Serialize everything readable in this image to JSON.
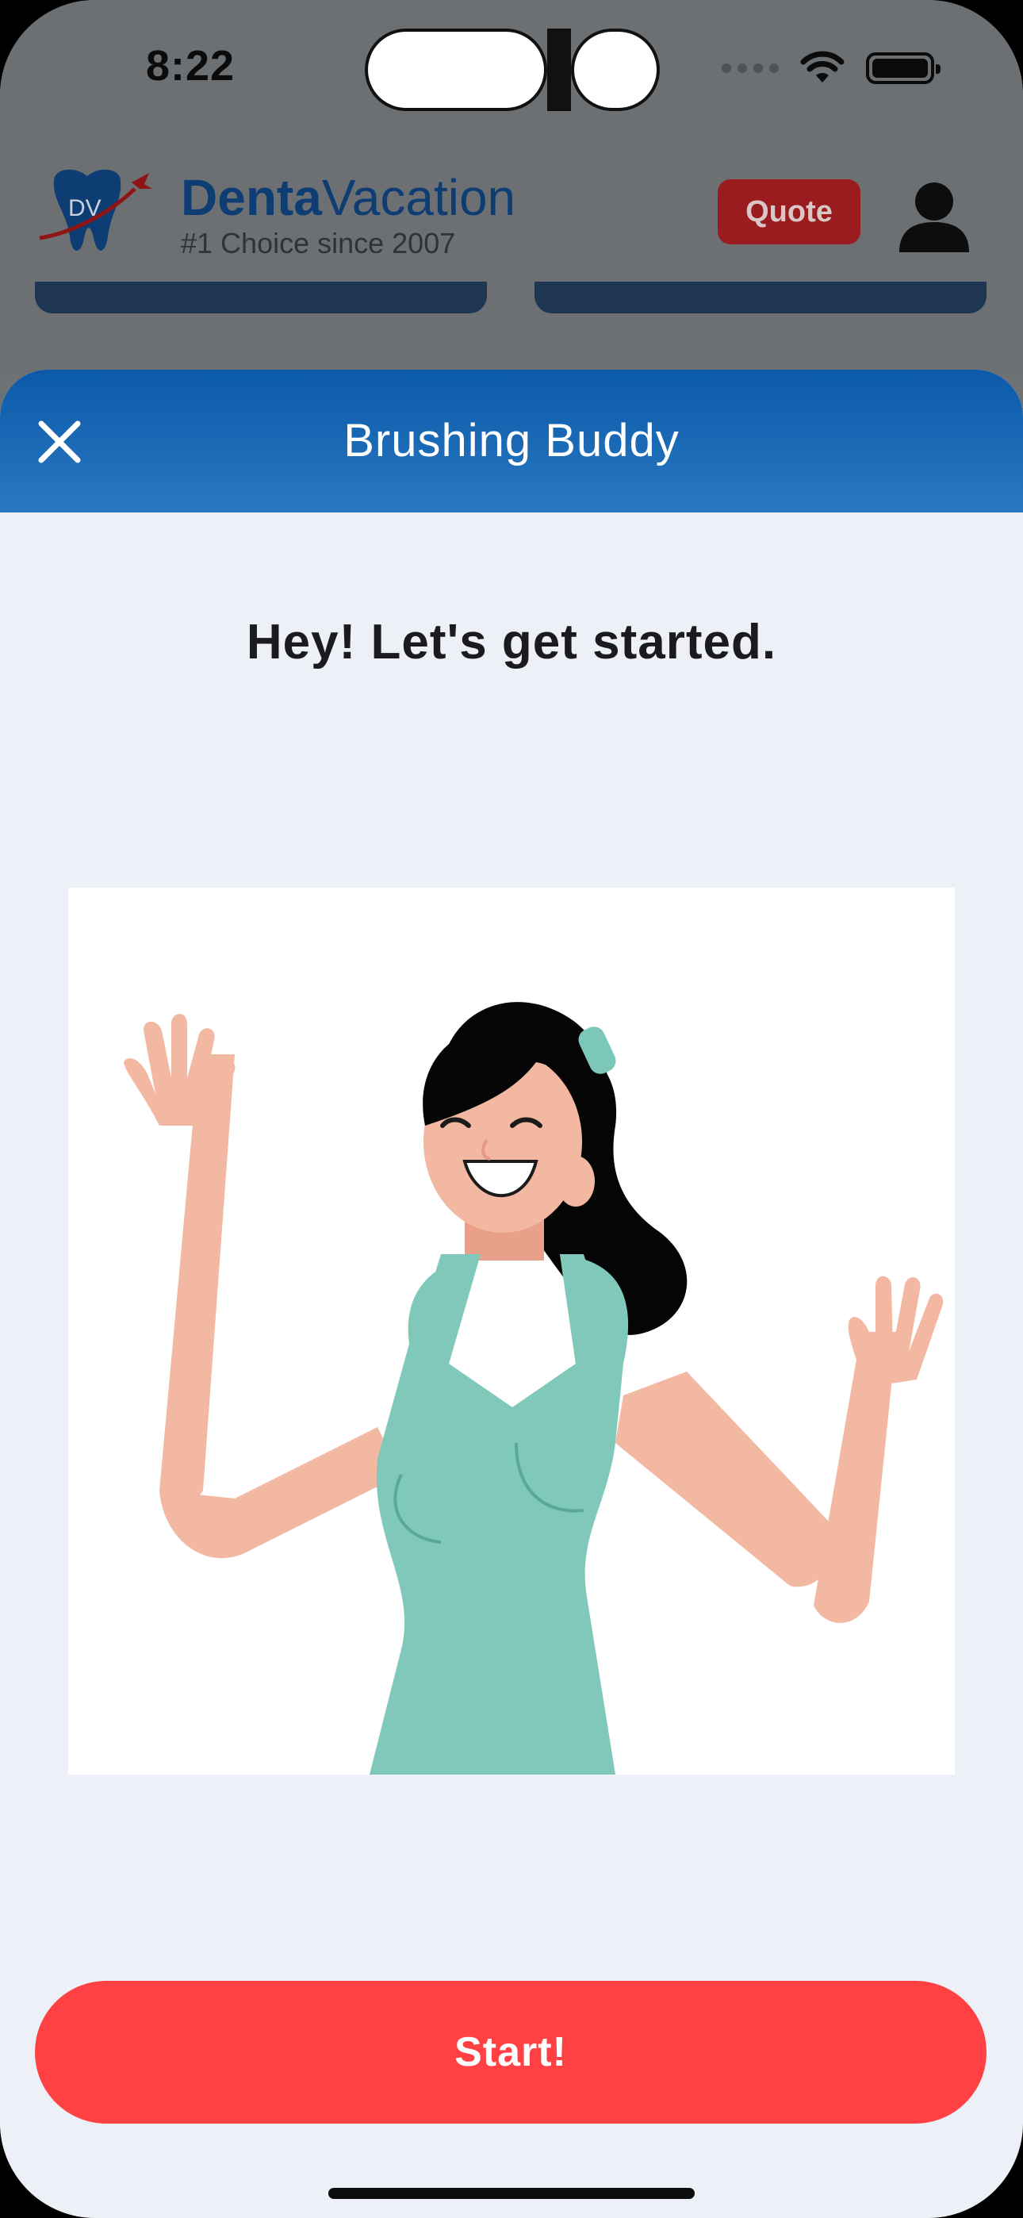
{
  "status_bar": {
    "time": "8:22"
  },
  "app": {
    "brand_bold": "Denta",
    "brand_light": "Vacation",
    "logo_letters": "DV",
    "tagline": "#1 Choice since 2007",
    "quote_label": "Quote"
  },
  "sheet": {
    "title": "Brushing Buddy",
    "greeting": "Hey! Let's get started.",
    "start_label": "Start!"
  },
  "colors": {
    "header_blue": "#0b5aa8",
    "start_red": "#ff4143",
    "sheet_bg": "#eef0f8",
    "quote_red": "#9b1c1f"
  }
}
